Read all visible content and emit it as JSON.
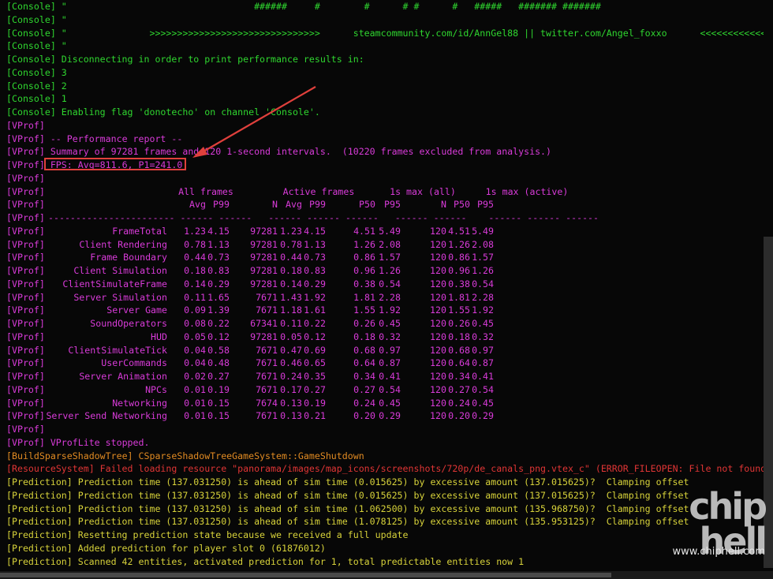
{
  "colors": {
    "console": "#2fd62f",
    "vprof": "#d93bd9",
    "build": "#e08a22",
    "error": "#e03535",
    "prediction": "#d7d23a",
    "highlight": "#e0403c"
  },
  "console_lines": [
    {
      "prefix": "[Console]",
      "text": "\"                                  ######     #        #      # #      #   #####   ####### #######"
    },
    {
      "prefix": "[Console]",
      "text": "\""
    },
    {
      "prefix": "[Console]",
      "text": "\"               >>>>>>>>>>>>>>>>>>>>>>>>>>>>>>>      steamcommunity.com/id/AnnGel88 || twitter.com/Angel_foxxo      <<<<<<<<<<<<<"
    },
    {
      "prefix": "[Console]",
      "text": "\""
    },
    {
      "prefix": "[Console]",
      "text": "Disconnecting in order to print performance results in:"
    },
    {
      "prefix": "[Console]",
      "text": "3"
    },
    {
      "prefix": "[Console]",
      "text": "2"
    },
    {
      "prefix": "[Console]",
      "text": "1"
    },
    {
      "prefix": "[Console]",
      "text": "Enabling flag 'donotecho' on channel 'Console'."
    }
  ],
  "vprof_intro": [
    {
      "prefix": "[VProf]",
      "text": ""
    },
    {
      "prefix": "[VProf]",
      "text": "-- Performance report --"
    },
    {
      "prefix": "[VProf]",
      "text": "Summary of 97281 frames and 120 1-second intervals.  (10220 frames excluded from analysis.)"
    },
    {
      "prefix": "[VProf]",
      "text": "FPS: Avg=811.6, P1=241.0"
    },
    {
      "prefix": "[VProf]",
      "text": ""
    }
  ],
  "table_header": {
    "prefix": "[VProf]",
    "group_all": "All frames",
    "group_active": "Active frames",
    "group_1s_all": "1s max (all)",
    "group_1s_active": "1s max (active)",
    "cols": [
      "Avg",
      "P99",
      "N",
      "Avg",
      "P99",
      "P50",
      "P95",
      "N",
      "P50",
      "P95"
    ],
    "separator": "----------------------- ------ ------   ------ ------ ------   ------ ------    ------ ------ ------"
  },
  "table_rows": [
    {
      "name": "FrameTotal",
      "v": [
        "1.23",
        "4.15",
        "97281",
        "1.23",
        "4.15",
        "4.51",
        "5.49",
        "120",
        "4.51",
        "5.49"
      ]
    },
    {
      "name": "Client Rendering",
      "v": [
        "0.78",
        "1.13",
        "97281",
        "0.78",
        "1.13",
        "1.26",
        "2.08",
        "120",
        "1.26",
        "2.08"
      ]
    },
    {
      "name": "Frame Boundary",
      "v": [
        "0.44",
        "0.73",
        "97281",
        "0.44",
        "0.73",
        "0.86",
        "1.57",
        "120",
        "0.86",
        "1.57"
      ]
    },
    {
      "name": "Client Simulation",
      "v": [
        "0.18",
        "0.83",
        "97281",
        "0.18",
        "0.83",
        "0.96",
        "1.26",
        "120",
        "0.96",
        "1.26"
      ]
    },
    {
      "name": "ClientSimulateFrame",
      "v": [
        "0.14",
        "0.29",
        "97281",
        "0.14",
        "0.29",
        "0.38",
        "0.54",
        "120",
        "0.38",
        "0.54"
      ]
    },
    {
      "name": "Server Simulation",
      "v": [
        "0.11",
        "1.65",
        "7671",
        "1.43",
        "1.92",
        "1.81",
        "2.28",
        "120",
        "1.81",
        "2.28"
      ]
    },
    {
      "name": "Server Game",
      "v": [
        "0.09",
        "1.39",
        "7671",
        "1.18",
        "1.61",
        "1.55",
        "1.92",
        "120",
        "1.55",
        "1.92"
      ]
    },
    {
      "name": "SoundOperators",
      "v": [
        "0.08",
        "0.22",
        "67341",
        "0.11",
        "0.22",
        "0.26",
        "0.45",
        "120",
        "0.26",
        "0.45"
      ]
    },
    {
      "name": "HUD",
      "v": [
        "0.05",
        "0.12",
        "97281",
        "0.05",
        "0.12",
        "0.18",
        "0.32",
        "120",
        "0.18",
        "0.32"
      ]
    },
    {
      "name": "ClientSimulateTick",
      "v": [
        "0.04",
        "0.58",
        "7671",
        "0.47",
        "0.69",
        "0.68",
        "0.97",
        "120",
        "0.68",
        "0.97"
      ]
    },
    {
      "name": "UserCommands",
      "v": [
        "0.04",
        "0.48",
        "7671",
        "0.46",
        "0.65",
        "0.64",
        "0.87",
        "120",
        "0.64",
        "0.87"
      ]
    },
    {
      "name": "Server Animation",
      "v": [
        "0.02",
        "0.27",
        "7671",
        "0.24",
        "0.35",
        "0.34",
        "0.41",
        "120",
        "0.34",
        "0.41"
      ]
    },
    {
      "name": "NPCs",
      "v": [
        "0.01",
        "0.19",
        "7671",
        "0.17",
        "0.27",
        "0.27",
        "0.54",
        "120",
        "0.27",
        "0.54"
      ]
    },
    {
      "name": "Networking",
      "v": [
        "0.01",
        "0.15",
        "7674",
        "0.13",
        "0.19",
        "0.24",
        "0.45",
        "120",
        "0.24",
        "0.45"
      ]
    },
    {
      "name": "Server Send Networking",
      "v": [
        "0.01",
        "0.15",
        "7671",
        "0.13",
        "0.21",
        "0.20",
        "0.29",
        "120",
        "0.20",
        "0.29"
      ]
    }
  ],
  "vprof_outro": [
    {
      "prefix": "[VProf]",
      "text": ""
    },
    {
      "prefix": "[VProf]",
      "text": "VProfLite stopped."
    }
  ],
  "build_line": {
    "prefix": "[BuildSparseShadowTree]",
    "text": "CSparseShadowTreeGameSystem::GameShutdown"
  },
  "error_line": {
    "prefix": "[ResourceSystem]",
    "text": "Failed loading resource \"panorama/images/map_icons/screenshots/720p/de_canals_png.vtex_c\" (ERROR_FILEOPEN: File not found)"
  },
  "prediction_lines": [
    {
      "prefix": "[Prediction]",
      "text": "Prediction time (137.031250) is ahead of sim time (0.015625) by excessive amount (137.015625)?  Clamping offset"
    },
    {
      "prefix": "[Prediction]",
      "text": "Prediction time (137.031250) is ahead of sim time (0.015625) by excessive amount (137.015625)?  Clamping offset"
    },
    {
      "prefix": "[Prediction]",
      "text": "Prediction time (137.031250) is ahead of sim time (1.062500) by excessive amount (135.968750)?  Clamping offset"
    },
    {
      "prefix": "[Prediction]",
      "text": "Prediction time (137.031250) is ahead of sim time (1.078125) by excessive amount (135.953125)?  Clamping offset"
    },
    {
      "prefix": "[Prediction]",
      "text": "Resetting prediction state because we received a full update"
    },
    {
      "prefix": "[Prediction]",
      "text": "Added prediction for player slot 0 (61876012)"
    },
    {
      "prefix": "[Prediction]",
      "text": "Scanned 42 entities, activated prediction for 1, total predictable entities now 1"
    }
  ],
  "watermark": {
    "logo": "chip\nhell",
    "site": "www.chiphell.com"
  }
}
